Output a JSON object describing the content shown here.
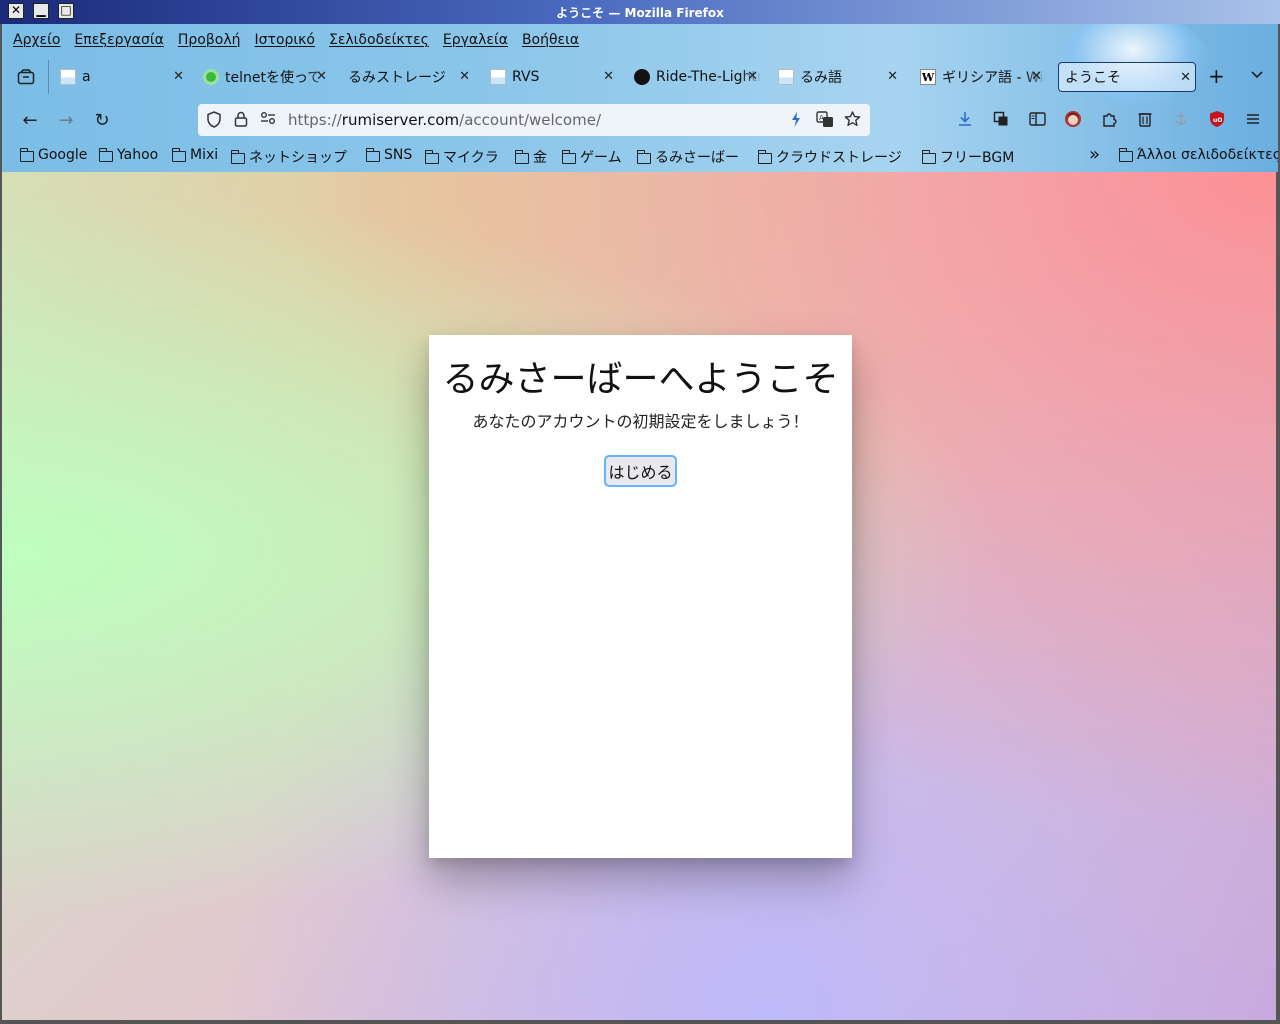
{
  "window": {
    "title": "ようこそ — Mozilla Firefox",
    "close_glyph": "✕",
    "minimize_glyph": "▁",
    "maximize_glyph": "□"
  },
  "menubar": [
    "Αρχείο",
    "Επεξεργασία",
    "Προβολή",
    "Ιστορικό",
    "Σελιδοδείκτες",
    "Εργαλεία",
    "Βοήθεια"
  ],
  "tabs": [
    {
      "title": "a",
      "favicon": "page-icon"
    },
    {
      "title": "telnetを使って",
      "favicon": "green-circle-icon"
    },
    {
      "title": "るみストレージ",
      "favicon": ""
    },
    {
      "title": "RVS",
      "favicon": "page-icon"
    },
    {
      "title": "Ride-The-Lightning",
      "favicon": "github-icon"
    },
    {
      "title": "るみ語",
      "favicon": "page-icon"
    },
    {
      "title": "ギリシア語 - Wikipedia",
      "favicon": "wikipedia-icon"
    },
    {
      "title": "ようこそ",
      "favicon": "",
      "active": true
    }
  ],
  "tab_close_glyph": "✕",
  "newtab_glyph": "+",
  "tablist_glyph": "⌄",
  "navbar": {
    "back_glyph": "←",
    "forward_glyph": "→",
    "reload_glyph": "↻",
    "url_scheme": "https://",
    "url_host": "rumiserver.com",
    "url_path": "/account/welcome/"
  },
  "bookmarks": [
    "Google",
    "Yahoo",
    "Mixi",
    "ネットショップ",
    "SNS",
    "マイクラ",
    "金",
    "ゲーム",
    "るみさーばー",
    "クラウドストレージ",
    "フリーBGM"
  ],
  "bookmarks_overflow_glyph": "»",
  "bookmarks_other": "Άλλοι σελιδοδείκτες",
  "page": {
    "heading": "るみさーばーへようこそ",
    "subtitle": "あなたのアカウントの初期設定をしましょう！",
    "start_button": "はじめる"
  },
  "colors": {
    "link_focus_ring": "#64b5ff",
    "ublock_red": "#c0161c"
  }
}
